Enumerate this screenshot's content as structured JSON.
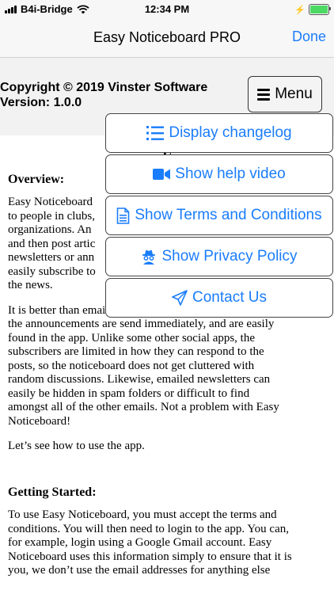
{
  "status_bar": {
    "carrier": "B4i-Bridge",
    "time": "12:34 PM",
    "battery_level": 1.0
  },
  "nav": {
    "title": "Easy Noticeboard PRO",
    "done_label": "Done"
  },
  "header": {
    "copyright": "Copyright © 2019 Vinster Software",
    "version": "Version: 1.0.0",
    "menu_label": "Menu"
  },
  "menu": {
    "items": [
      {
        "label": "Display changelog",
        "icon": "list-icon"
      },
      {
        "label": "Show help video",
        "icon": "video-camera-icon"
      },
      {
        "label": "Show Terms and Conditions",
        "icon": "document-icon"
      },
      {
        "label": "Show Privacy Policy",
        "icon": "incognito-icon"
      },
      {
        "label": "Contact Us",
        "icon": "paper-plane-icon"
      }
    ]
  },
  "document": {
    "title": "E",
    "overview_heading": "Overview:",
    "overview_fragment_lines": [
      "Easy Noticeboard",
      "to people in clubs,",
      "organizations. An",
      "and then post artic",
      "newsletters or ann",
      "easily subscribe to",
      "the news."
    ],
    "paragraph_2_lines": [
      "It is better than email or other social media apps because",
      "the announcements are send immediately, and are easily",
      "found in the app. Unlike some other social apps, the",
      "subscribers are limited in how they can respond to the",
      "posts, so the noticeboard does not get cluttered with",
      "random discussions. Likewise, emailed newsletters can",
      "easily be hidden in spam folders or difficult to find",
      "amongst all of the other emails. Not a problem with Easy",
      "Noticeboard!"
    ],
    "paragraph_3": "Let’s see how to use the app.",
    "getting_started_heading": "Getting Started:",
    "paragraph_4_lines": [
      "To use Easy Noticeboard, you must accept the terms and",
      "conditions. You will then need to login to the app. You can,",
      "for example, login using a Google Gmail account. Easy",
      "Noticeboard uses this information simply to ensure that it is",
      "you, we don’t use the email addresses for anything else"
    ]
  }
}
